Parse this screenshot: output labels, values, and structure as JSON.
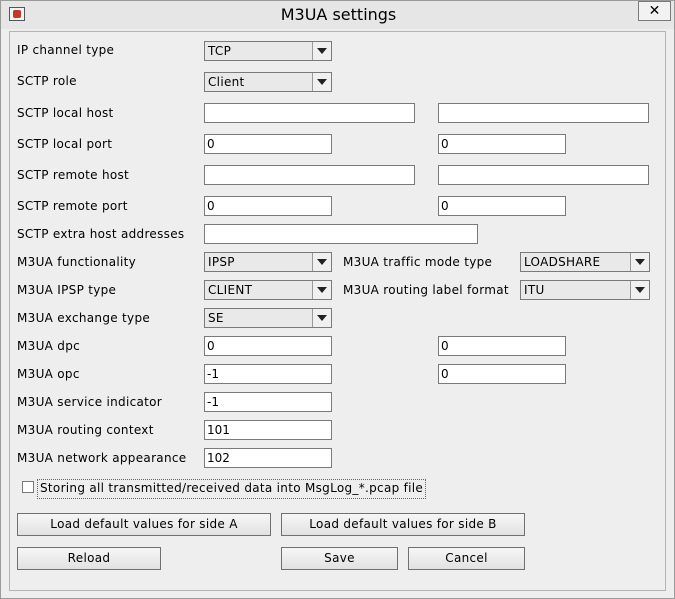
{
  "window": {
    "title": "M3UA settings",
    "close_glyph": "✕"
  },
  "fields": {
    "ip_channel_type": {
      "label": "IP channel type",
      "value": "TCP"
    },
    "sctp_role": {
      "label": "SCTP role",
      "value": "Client"
    },
    "sctp_local_host": {
      "label": "SCTP local host",
      "value_a": "",
      "value_b": ""
    },
    "sctp_local_port": {
      "label": "SCTP local port",
      "value_a": "0",
      "value_b": "0"
    },
    "sctp_remote_host": {
      "label": "SCTP remote host",
      "value_a": "",
      "value_b": ""
    },
    "sctp_remote_port": {
      "label": "SCTP remote port",
      "value_a": "0",
      "value_b": "0"
    },
    "sctp_extra_hosts": {
      "label": "SCTP extra host addresses",
      "value": ""
    },
    "m3ua_functionality": {
      "label": "M3UA functionality",
      "value": "IPSP"
    },
    "m3ua_traffic_mode": {
      "label": "M3UA traffic mode type",
      "value": "LOADSHARE"
    },
    "m3ua_ipsp_type": {
      "label": "M3UA IPSP type",
      "value": "CLIENT"
    },
    "m3ua_routing_label": {
      "label": "M3UA routing label format",
      "value": "ITU"
    },
    "m3ua_exchange_type": {
      "label": "M3UA exchange type",
      "value": "SE"
    },
    "m3ua_dpc": {
      "label": "M3UA dpc",
      "value_a": "0",
      "value_b": "0"
    },
    "m3ua_opc": {
      "label": "M3UA opc",
      "value_a": "-1",
      "value_b": "0"
    },
    "m3ua_service_indicator": {
      "label": "M3UA service indicator",
      "value": "-1"
    },
    "m3ua_routing_context": {
      "label": "M3UA routing context",
      "value": "101"
    },
    "m3ua_network_appearance": {
      "label": "M3UA network appearance",
      "value": "102"
    }
  },
  "storing_option": {
    "label": "Storing all transmitted/received data into MsgLog_*.pcap file",
    "checked": false
  },
  "buttons": {
    "load_a": "Load default values for side A",
    "load_b": "Load default values for side B",
    "reload": "Reload",
    "save": "Save",
    "cancel": "Cancel"
  }
}
